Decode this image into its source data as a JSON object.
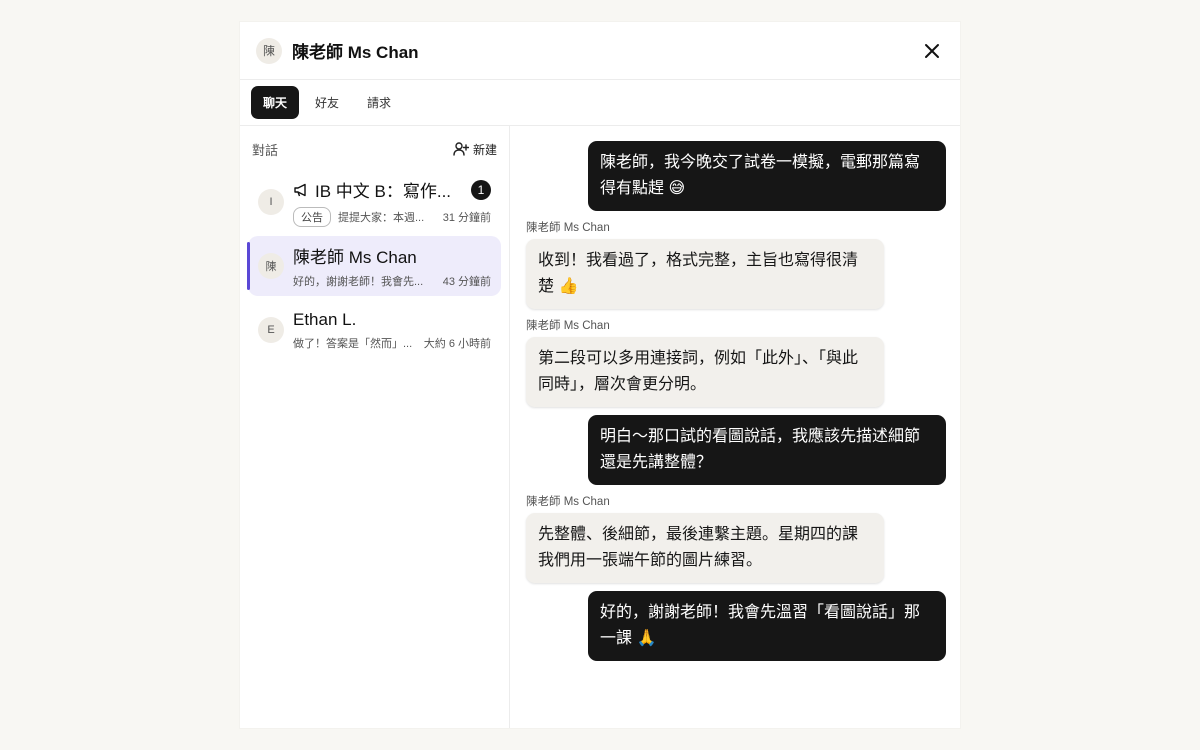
{
  "header": {
    "avatar_initial": "陳",
    "title": "陳老師 Ms Chan"
  },
  "tabs": [
    {
      "label": "聊天",
      "active": true
    },
    {
      "label": "好友",
      "active": false
    },
    {
      "label": "請求",
      "active": false
    }
  ],
  "sidebar": {
    "heading": "對話",
    "new_label": "新建",
    "conversations": [
      {
        "initial": "I",
        "name": "IB 中文 B：寫作...",
        "tag": "公告",
        "preview": "提提大家：本週...",
        "time": "31 分鐘前",
        "unread": "1",
        "active": false
      },
      {
        "initial": "陳",
        "name": "陳老師 Ms Chan",
        "preview": "好的，謝謝老師！我會先...",
        "time": "43 分鐘前",
        "active": true
      },
      {
        "initial": "E",
        "name": "Ethan L.",
        "preview": "做了！答案是「然而」...",
        "time": "大約 6 小時前",
        "active": false
      }
    ]
  },
  "messages": [
    {
      "from": "me",
      "text": "陳老師，我今晚交了試卷一模擬，電郵那篇寫得有點趕 😅"
    },
    {
      "from": "them",
      "sender": "陳老師 Ms Chan",
      "text": "收到！我看過了，格式完整，主旨也寫得很清楚 👍"
    },
    {
      "from": "them",
      "sender": "陳老師 Ms Chan",
      "text": "第二段可以多用連接詞，例如「此外」、「與此同時」，層次會更分明。"
    },
    {
      "from": "me",
      "text": "明白～那口試的看圖說話，我應該先描述細節還是先講整體？"
    },
    {
      "from": "them",
      "sender": "陳老師 Ms Chan",
      "text": "先整體、後細節，最後連繫主題。星期四的課我們用一張端午節的圖片練習。"
    },
    {
      "from": "me",
      "text": "好的，謝謝老師！我會先溫習「看圖說話」那一課 🙏"
    }
  ],
  "colors": {
    "accent": "#5a48d6",
    "dark": "#161616",
    "active_row": "#eeecfb"
  }
}
